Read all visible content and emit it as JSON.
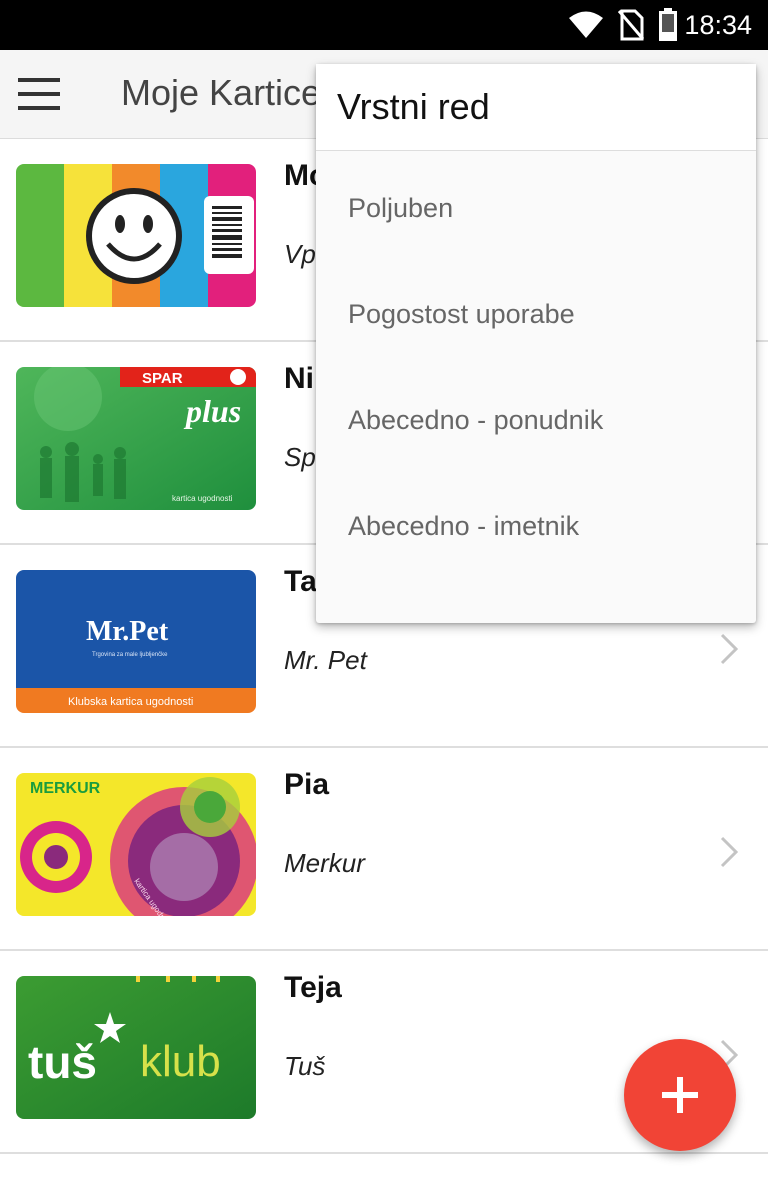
{
  "status_bar": {
    "time": "18:34"
  },
  "app_bar": {
    "title": "Moje Kartice"
  },
  "cards": [
    {
      "holder": "Mo",
      "provider": "Vp",
      "image": "smiley-card"
    },
    {
      "holder": "Ni",
      "provider": "Sp",
      "image": "spar-plus-card",
      "image_text": {
        "brand": "SPAR",
        "name": "plus",
        "footer": "kartica ugodnosti"
      }
    },
    {
      "holder": "Ta",
      "provider": "Mr. Pet",
      "image": "mr-pet-card",
      "image_text": {
        "brand": "Mr.Pet",
        "tagline": "Trgovina za male ljubljenčke",
        "footer": "Klubska kartica ugodnosti"
      }
    },
    {
      "holder": "Pia",
      "provider": "Merkur",
      "image": "merkur-card",
      "image_text": {
        "brand": "MERKUR",
        "footer": "kartica ugodnosti"
      }
    },
    {
      "holder": "Teja",
      "provider": "Tuš",
      "image": "tus-klub-card",
      "image_text": {
        "brand": "tuš",
        "name": "klub"
      }
    }
  ],
  "sort_menu": {
    "title": "Vrstni red",
    "items": [
      "Poljuben",
      "Pogostost uporabe",
      "Abecedno - ponudnik",
      "Abecedno - imetnik"
    ]
  },
  "fab": {
    "icon": "plus-icon"
  },
  "colors": {
    "fab": "#f14436",
    "app_bar": "#f5f5f5",
    "status_bar": "#000000"
  }
}
